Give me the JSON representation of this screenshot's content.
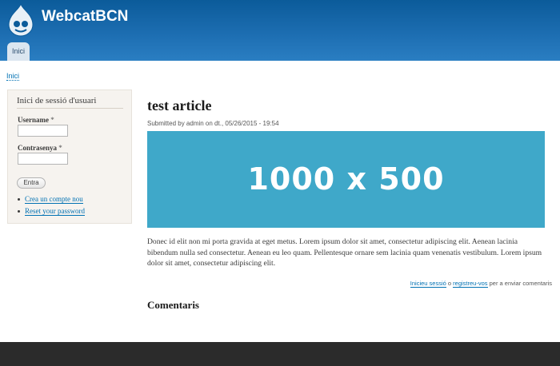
{
  "header": {
    "site_name": "WebcatBCN",
    "logo_icon": "drupal-drop-icon",
    "tabs": [
      {
        "label": "Inici"
      }
    ]
  },
  "breadcrumb": {
    "items": [
      {
        "label": "Inici"
      }
    ]
  },
  "sidebar": {
    "login_block": {
      "title": "Inici de sessió d'usuari",
      "username_label": "Username",
      "username_value": "",
      "password_label": "Contrasenya",
      "password_value": "",
      "required_marker": "*",
      "submit_label": "Entra",
      "links": [
        {
          "label": "Crea un compte nou"
        },
        {
          "label": "Reset your password"
        }
      ]
    }
  },
  "article": {
    "title": "test article",
    "submitted": "Submitted by admin on dt., 05/26/2015 - 19:54",
    "image_text": "1000 x 500",
    "image_color": "#3fa8c9",
    "body": "Donec id elit non mi porta gravida at eget metus. Lorem ipsum dolor sit amet, consectetur adipiscing elit. Aenean lacinia bibendum nulla sed consectetur. Aenean eu leo quam. Pellentesque ornare sem lacinia quam venenatis vestibulum. Lorem ipsum dolor sit amet, consectetur adipiscing elit."
  },
  "comments": {
    "login_link": "Inicieu sessió",
    "connector": "o",
    "register_link": "registreu-vos",
    "suffix": "per a enviar comentaris",
    "title": "Comentaris"
  },
  "colors": {
    "header": "#1e6fb3",
    "link": "#0071b3",
    "sidebar_bg": "#f6f3ef",
    "footer": "#2b2b2b"
  }
}
